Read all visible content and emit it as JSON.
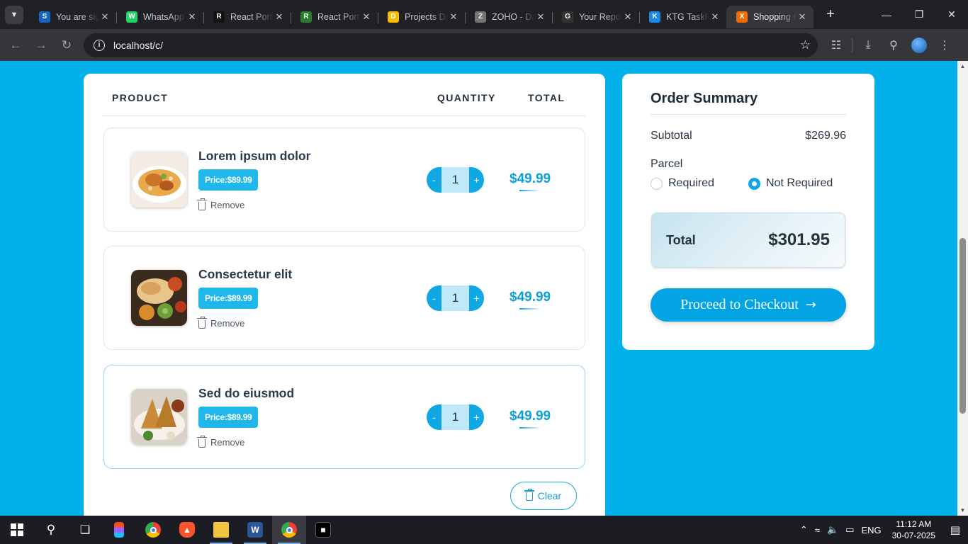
{
  "browser": {
    "tabs": [
      {
        "title": "You are signed in",
        "favicon": "S",
        "favicon_color": "#1565c0",
        "active": false
      },
      {
        "title": "WhatsApp",
        "favicon": "W",
        "favicon_color": "#25d366",
        "active": false
      },
      {
        "title": "React Portfolio",
        "favicon": "R",
        "favicon_color": "#111111",
        "active": false
      },
      {
        "title": "React Portfolio",
        "favicon": "R",
        "favicon_color": "#2e7d32",
        "active": false
      },
      {
        "title": "Projects Drive",
        "favicon": "D",
        "favicon_color": "#fbbc04",
        "active": false
      },
      {
        "title": "ZOHO - Dashboard",
        "favicon": "Z",
        "favicon_color": "#757575",
        "active": false
      },
      {
        "title": "Your Repositories",
        "favicon": "G",
        "favicon_color": "#333333",
        "active": false
      },
      {
        "title": "KTG TaskFlow",
        "favicon": "K",
        "favicon_color": "#1e88e5",
        "active": false
      },
      {
        "title": "Shopping Cart",
        "favicon": "X",
        "favicon_color": "#ef6c00",
        "active": true
      }
    ],
    "url": "localhost/c/"
  },
  "cart": {
    "headers": {
      "product": "PRODUCT",
      "quantity": "QUANTITY",
      "total": "TOTAL"
    },
    "items": [
      {
        "name": "Lorem ipsum dolor",
        "price": "Price:$89.99",
        "remove": "Remove",
        "quantity": "1",
        "total": "$49.99",
        "image": "biryani-plate"
      },
      {
        "name": "Consectetur elit",
        "price": "Price:$89.99",
        "remove": "Remove",
        "quantity": "1",
        "total": "$49.99",
        "image": "thali-platter"
      },
      {
        "name": "Sed do eiusmod",
        "price": "Price:$89.99",
        "remove": "Remove",
        "quantity": "1",
        "total": "$49.99",
        "image": "samosa-plate"
      }
    ],
    "qty_minus": "-",
    "qty_plus": "+",
    "clear_label": "Clear"
  },
  "summary": {
    "title": "Order Summary",
    "subtotal_label": "Subtotal",
    "subtotal_value": "$269.96",
    "parcel_label": "Parcel",
    "options": [
      {
        "label": "Required",
        "selected": false
      },
      {
        "label": "Not Required",
        "selected": true
      }
    ],
    "total_label": "Total",
    "total_value": "$301.95",
    "checkout_label": "Proceed to Checkout",
    "accent_color": "#02a4e3"
  },
  "taskbar": {
    "language": "ENG",
    "time": "11:12 AM",
    "date": "30-07-2025"
  }
}
